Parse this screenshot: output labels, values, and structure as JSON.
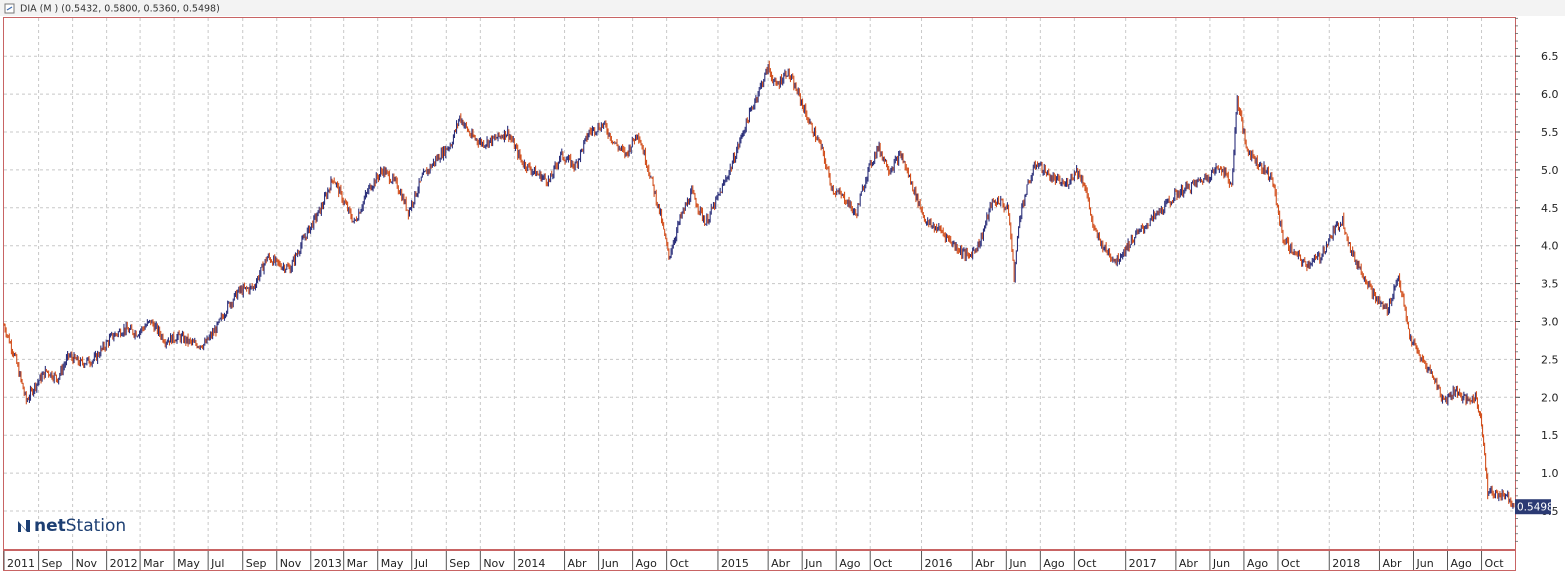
{
  "title": "DIA (M ) (0.5432, 0.5800, 0.5360, 0.5498)",
  "logo": {
    "text_bold": "net",
    "text_rest": "Station"
  },
  "colors": {
    "up": "#2b2f7a",
    "down": "#d2501e",
    "grid": "#c8c8c8",
    "frame": "#c86464",
    "badge": "#2b3a73"
  },
  "chart_data": {
    "type": "line",
    "ylim": [
      0,
      7
    ],
    "y_ticks": [
      0.5,
      1.0,
      1.5,
      2.0,
      2.5,
      3.0,
      3.5,
      4.0,
      4.5,
      5.0,
      5.5,
      6.0,
      6.5
    ],
    "y_tick_labels": [
      "0.5",
      "1.0",
      "1.5",
      "2.0",
      "2.5",
      "3.0",
      "3.5",
      "4.0",
      "4.5",
      "5.0",
      "5.5",
      "6.0",
      "6.5"
    ],
    "last_value_label": "0.5498",
    "last_value": 0.5498,
    "x_start": "2011-07-01",
    "x_end": "2018-11-30",
    "x_ticks": [
      {
        "label": "2011",
        "date": "2011-07-01"
      },
      {
        "label": "Sep",
        "date": "2011-09-01"
      },
      {
        "label": "Nov",
        "date": "2011-11-01"
      },
      {
        "label": "2012",
        "date": "2012-01-01"
      },
      {
        "label": "Mar",
        "date": "2012-03-01"
      },
      {
        "label": "May",
        "date": "2012-05-01"
      },
      {
        "label": "Jul",
        "date": "2012-07-01"
      },
      {
        "label": "Sep",
        "date": "2012-09-01"
      },
      {
        "label": "Nov",
        "date": "2012-11-01"
      },
      {
        "label": "2013",
        "date": "2013-01-01"
      },
      {
        "label": "Mar",
        "date": "2013-03-01"
      },
      {
        "label": "May",
        "date": "2013-05-01"
      },
      {
        "label": "Jul",
        "date": "2013-07-01"
      },
      {
        "label": "Sep",
        "date": "2013-09-01"
      },
      {
        "label": "Nov",
        "date": "2013-11-01"
      },
      {
        "label": "2014",
        "date": "2014-01-01"
      },
      {
        "label": "Abr",
        "date": "2014-04-01"
      },
      {
        "label": "Jun",
        "date": "2014-06-01"
      },
      {
        "label": "Ago",
        "date": "2014-08-01"
      },
      {
        "label": "Oct",
        "date": "2014-10-01"
      },
      {
        "label": "2015",
        "date": "2015-01-01"
      },
      {
        "label": "Abr",
        "date": "2015-04-01"
      },
      {
        "label": "Jun",
        "date": "2015-06-01"
      },
      {
        "label": "Ago",
        "date": "2015-08-01"
      },
      {
        "label": "Oct",
        "date": "2015-10-01"
      },
      {
        "label": "2016",
        "date": "2016-01-01"
      },
      {
        "label": "Abr",
        "date": "2016-04-01"
      },
      {
        "label": "Jun",
        "date": "2016-06-01"
      },
      {
        "label": "Ago",
        "date": "2016-08-01"
      },
      {
        "label": "Oct",
        "date": "2016-10-01"
      },
      {
        "label": "2017",
        "date": "2017-01-01"
      },
      {
        "label": "Abr",
        "date": "2017-04-01"
      },
      {
        "label": "Jun",
        "date": "2017-06-01"
      },
      {
        "label": "Ago",
        "date": "2017-08-01"
      },
      {
        "label": "Oct",
        "date": "2017-10-01"
      },
      {
        "label": "2018",
        "date": "2018-01-01"
      },
      {
        "label": "Abr",
        "date": "2018-04-01"
      },
      {
        "label": "Jun",
        "date": "2018-06-01"
      },
      {
        "label": "Ago",
        "date": "2018-08-01"
      },
      {
        "label": "Oct",
        "date": "2018-10-01"
      }
    ],
    "series": [
      {
        "points": [
          [
            "2011-07-01",
            2.95
          ],
          [
            "2011-07-20",
            2.55
          ],
          [
            "2011-08-10",
            1.95
          ],
          [
            "2011-08-25",
            2.15
          ],
          [
            "2011-09-15",
            2.35
          ],
          [
            "2011-10-05",
            2.25
          ],
          [
            "2011-10-25",
            2.55
          ],
          [
            "2011-11-15",
            2.45
          ],
          [
            "2011-12-10",
            2.5
          ],
          [
            "2012-01-10",
            2.8
          ],
          [
            "2012-02-01",
            2.9
          ],
          [
            "2012-02-25",
            2.85
          ],
          [
            "2012-03-20",
            3.0
          ],
          [
            "2012-04-15",
            2.75
          ],
          [
            "2012-05-10",
            2.8
          ],
          [
            "2012-06-05",
            2.7
          ],
          [
            "2012-06-25",
            2.7
          ],
          [
            "2012-07-15",
            2.9
          ],
          [
            "2012-08-05",
            3.2
          ],
          [
            "2012-08-25",
            3.4
          ],
          [
            "2012-09-20",
            3.45
          ],
          [
            "2012-10-15",
            3.85
          ],
          [
            "2012-11-05",
            3.75
          ],
          [
            "2012-11-25",
            3.7
          ],
          [
            "2012-12-20",
            4.1
          ],
          [
            "2013-01-20",
            4.5
          ],
          [
            "2013-02-10",
            4.9
          ],
          [
            "2013-02-28",
            4.6
          ],
          [
            "2013-03-20",
            4.3
          ],
          [
            "2013-04-15",
            4.75
          ],
          [
            "2013-05-10",
            5.0
          ],
          [
            "2013-06-05",
            4.8
          ],
          [
            "2013-06-25",
            4.45
          ],
          [
            "2013-07-20",
            4.9
          ],
          [
            "2013-08-15",
            5.15
          ],
          [
            "2013-09-10",
            5.35
          ],
          [
            "2013-09-25",
            5.7
          ],
          [
            "2013-10-15",
            5.45
          ],
          [
            "2013-11-05",
            5.35
          ],
          [
            "2013-11-25",
            5.4
          ],
          [
            "2013-12-20",
            5.5
          ],
          [
            "2014-01-15",
            5.1
          ],
          [
            "2014-02-10",
            4.95
          ],
          [
            "2014-03-05",
            4.85
          ],
          [
            "2014-03-25",
            5.2
          ],
          [
            "2014-04-20",
            5.05
          ],
          [
            "2014-05-15",
            5.5
          ],
          [
            "2014-06-10",
            5.6
          ],
          [
            "2014-06-30",
            5.35
          ],
          [
            "2014-07-20",
            5.2
          ],
          [
            "2014-08-10",
            5.5
          ],
          [
            "2014-08-30",
            5.0
          ],
          [
            "2014-09-20",
            4.4
          ],
          [
            "2014-10-05",
            3.85
          ],
          [
            "2014-10-25",
            4.35
          ],
          [
            "2014-11-15",
            4.7
          ],
          [
            "2014-12-10",
            4.3
          ],
          [
            "2015-01-05",
            4.7
          ],
          [
            "2015-01-25",
            5.05
          ],
          [
            "2015-02-15",
            5.5
          ],
          [
            "2015-03-10",
            5.95
          ],
          [
            "2015-04-01",
            6.35
          ],
          [
            "2015-04-15",
            6.1
          ],
          [
            "2015-05-05",
            6.3
          ],
          [
            "2015-05-25",
            6.0
          ],
          [
            "2015-06-15",
            5.6
          ],
          [
            "2015-07-05",
            5.3
          ],
          [
            "2015-07-25",
            4.75
          ],
          [
            "2015-08-20",
            4.6
          ],
          [
            "2015-09-05",
            4.4
          ],
          [
            "2015-09-25",
            4.95
          ],
          [
            "2015-10-15",
            5.3
          ],
          [
            "2015-11-05",
            5.0
          ],
          [
            "2015-11-25",
            5.2
          ],
          [
            "2015-12-20",
            4.7
          ],
          [
            "2016-01-10",
            4.3
          ],
          [
            "2016-02-05",
            4.2
          ],
          [
            "2016-03-01",
            4.0
          ],
          [
            "2016-03-25",
            3.85
          ],
          [
            "2016-04-15",
            4.05
          ],
          [
            "2016-05-05",
            4.55
          ],
          [
            "2016-05-20",
            4.6
          ],
          [
            "2016-06-05",
            4.45
          ],
          [
            "2016-06-15",
            3.6
          ],
          [
            "2016-06-25",
            4.4
          ],
          [
            "2016-07-10",
            4.8
          ],
          [
            "2016-07-25",
            5.1
          ],
          [
            "2016-08-20",
            4.9
          ],
          [
            "2016-09-15",
            4.8
          ],
          [
            "2016-10-05",
            5.0
          ],
          [
            "2016-10-20",
            4.8
          ],
          [
            "2016-11-05",
            4.2
          ],
          [
            "2016-11-25",
            3.95
          ],
          [
            "2016-12-15",
            3.8
          ],
          [
            "2017-01-15",
            4.1
          ],
          [
            "2017-02-10",
            4.3
          ],
          [
            "2017-03-10",
            4.5
          ],
          [
            "2017-04-05",
            4.7
          ],
          [
            "2017-05-01",
            4.8
          ],
          [
            "2017-05-25",
            4.9
          ],
          [
            "2017-06-20",
            5.05
          ],
          [
            "2017-07-10",
            4.8
          ],
          [
            "2017-07-20",
            5.95
          ],
          [
            "2017-08-05",
            5.3
          ],
          [
            "2017-08-25",
            5.1
          ],
          [
            "2017-09-20",
            4.9
          ],
          [
            "2017-10-10",
            4.1
          ],
          [
            "2017-10-30",
            3.9
          ],
          [
            "2017-11-20",
            3.75
          ],
          [
            "2017-12-15",
            3.85
          ],
          [
            "2018-01-10",
            4.2
          ],
          [
            "2018-01-25",
            4.35
          ],
          [
            "2018-02-10",
            3.9
          ],
          [
            "2018-03-05",
            3.6
          ],
          [
            "2018-03-25",
            3.3
          ],
          [
            "2018-04-15",
            3.15
          ],
          [
            "2018-05-05",
            3.6
          ],
          [
            "2018-05-25",
            2.8
          ],
          [
            "2018-06-15",
            2.5
          ],
          [
            "2018-07-05",
            2.3
          ],
          [
            "2018-07-25",
            1.95
          ],
          [
            "2018-08-15",
            2.1
          ],
          [
            "2018-09-05",
            1.95
          ],
          [
            "2018-09-20",
            2.0
          ],
          [
            "2018-10-01",
            1.7
          ],
          [
            "2018-10-12",
            0.75
          ],
          [
            "2018-10-30",
            0.72
          ],
          [
            "2018-11-15",
            0.72
          ],
          [
            "2018-11-30",
            0.5498
          ]
        ]
      }
    ]
  }
}
